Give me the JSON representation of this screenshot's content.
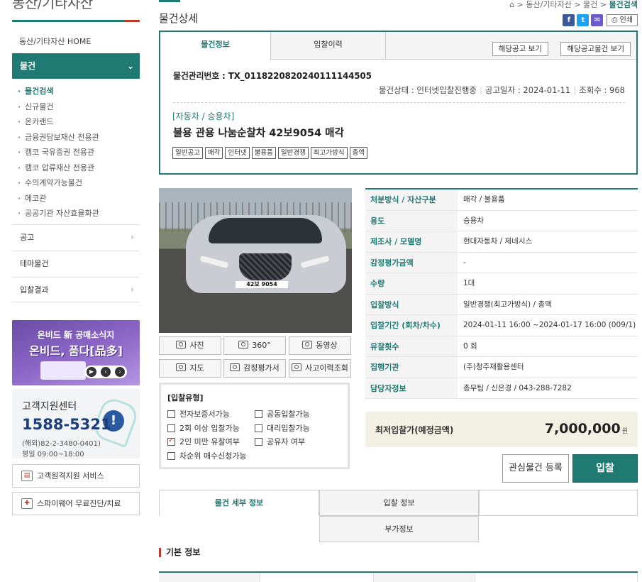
{
  "sidebar": {
    "section_title": "동산/기타자산",
    "home_link": "동산/기타자산 HOME",
    "active_menu": "물건",
    "sub_items": [
      "물건검색",
      "신규물건",
      "온카랜드",
      "금융권담보재산 전용관",
      "캠코 국유증권 전용관",
      "캠코 압류재산 전용관",
      "수의계약가능물건",
      "에코관",
      "공공기관 자산효율화관"
    ],
    "menus": [
      "공고",
      "테마물건",
      "입찰결과"
    ],
    "banner": {
      "line1": "온비드 新 공매소식지",
      "line2": "온비드, 품다[品多]"
    },
    "support": {
      "title": "고객지원센터",
      "phone": "1588-5321",
      "overseas": "(해외)82-2-3480-0401)",
      "hours": "평일 09:00~18:00"
    },
    "services": [
      "고객원격지원 서비스",
      "스파이웨어 무료진단/치료"
    ]
  },
  "header": {
    "page_title": "물건상세",
    "breadcrumb": [
      "동산/기타자산",
      "물건",
      "물건검색"
    ],
    "print_label": "인쇄",
    "share_icons": {
      "facebook": "f",
      "twitter": "t",
      "mail": "✉"
    }
  },
  "info": {
    "tabs": [
      "물건정보",
      "입찰이력"
    ],
    "notice_buttons": [
      "해당공고 보기",
      "해당공고물건 보기"
    ],
    "mgmt_no": "물건관리번호 : TX_0118220820240111144505",
    "status": "물건상태 : 인터넷입찰진행중",
    "notice_date": "공고일자 : 2024-01-11",
    "views": "조회수 : 968",
    "category": "[자동차 / 승용차]",
    "title": "불용 관용 나눔순찰차 42보9054 매각",
    "tags": [
      "일반공고",
      "매각",
      "인터넷",
      "불용품",
      "일반경쟁",
      "최고가방식",
      "총액"
    ]
  },
  "photo": {
    "plate": "42보 9054"
  },
  "media_buttons": [
    "사진",
    "360°",
    "동영상",
    "지도",
    "감정평가서",
    "사고이력조회"
  ],
  "bid_type": {
    "heading": "[입찰유형]",
    "options": [
      {
        "label": "전자보증서가능",
        "checked": false
      },
      {
        "label": "공동입찰가능",
        "checked": false
      },
      {
        "label": "2회 이상 입찰가능",
        "checked": false
      },
      {
        "label": "대리입찰가능",
        "checked": false
      },
      {
        "label": "2인 미만 유찰여부",
        "checked": true
      },
      {
        "label": "공유자 여부",
        "checked": false
      },
      {
        "label": "차순위 매수신청가능",
        "checked": false
      }
    ]
  },
  "details": [
    {
      "k": "처분방식 / 자산구분",
      "v": "매각 / 불용품"
    },
    {
      "k": "용도",
      "v": "승용차"
    },
    {
      "k": "제조사 / 모델명",
      "v": "현대자동차 / 제네시스"
    },
    {
      "k": "감정평가금액",
      "v": "-"
    },
    {
      "k": "수량",
      "v": "1대"
    },
    {
      "k": "입찰방식",
      "v": "일반경쟁(최고가방식) / 총액"
    },
    {
      "k": "입찰기간 (회차/차수)",
      "v": "2024-01-11 16:00 ~2024-01-17 16:00 (009/1)"
    },
    {
      "k": "유찰횟수",
      "v": "0 회"
    },
    {
      "k": "집행기관",
      "v": "(주)청주재활용센터"
    },
    {
      "k": "담당자정보",
      "v": "총무팀 / 신은경 / 043-288-7282"
    }
  ],
  "price": {
    "label": "최저입찰가(예정금액)",
    "value": "7,000,000",
    "unit": "원"
  },
  "actions": {
    "interest": "관심물건 등록",
    "bid": "입찰"
  },
  "bottom_tabs": [
    "물건 세부 정보",
    "입찰 정보",
    "부가정보"
  ],
  "section_title": "기본 정보",
  "colors": {
    "brand": "#1f7a74",
    "accent_red": "#c0392b"
  }
}
